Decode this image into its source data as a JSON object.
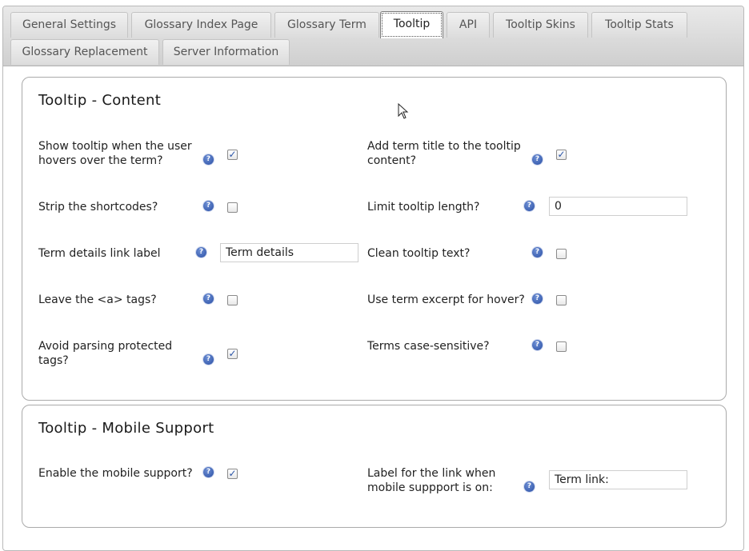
{
  "tabs": [
    {
      "label": "General Settings"
    },
    {
      "label": "Glossary Index Page"
    },
    {
      "label": "Glossary Term"
    },
    {
      "label": "Tooltip"
    },
    {
      "label": "API"
    },
    {
      "label": "Tooltip Skins"
    },
    {
      "label": "Tooltip Stats"
    },
    {
      "label": "Glossary Replacement"
    },
    {
      "label": "Server Information"
    }
  ],
  "active_tab": "Tooltip",
  "content_section": {
    "title": "Tooltip - Content",
    "fields": [
      {
        "label_lines": [
          "Show tooltip when the user",
          "hovers over the term?"
        ],
        "type": "checkbox",
        "checked": true
      },
      {
        "label_lines": [
          "Add term title to the tooltip",
          "content?"
        ],
        "type": "checkbox",
        "checked": true
      },
      {
        "label_lines": [
          "Strip the shortcodes?"
        ],
        "type": "checkbox",
        "checked": false
      },
      {
        "label_lines": [
          "Limit tooltip length?"
        ],
        "type": "text",
        "value": "0"
      },
      {
        "label_lines": [
          "Term details link label"
        ],
        "type": "text",
        "value": "Term details"
      },
      {
        "label_lines": [
          "Clean tooltip text?"
        ],
        "type": "checkbox",
        "checked": false
      },
      {
        "label_lines": [
          "Leave the <a> tags?"
        ],
        "type": "checkbox",
        "checked": false
      },
      {
        "label_lines": [
          "Use term excerpt for hover?"
        ],
        "type": "checkbox",
        "checked": false
      },
      {
        "label_lines": [
          "Avoid parsing protected",
          "tags?"
        ],
        "type": "checkbox",
        "checked": true
      },
      {
        "label_lines": [
          "Terms case-sensitive?"
        ],
        "type": "checkbox",
        "checked": false
      }
    ]
  },
  "mobile_section": {
    "title": "Tooltip - Mobile Support",
    "fields": [
      {
        "label_lines": [
          "Enable the mobile support?"
        ],
        "type": "checkbox",
        "checked": true
      },
      {
        "label_lines": [
          "Label for the link when",
          "mobile suppport is on:"
        ],
        "type": "text",
        "value": "Term link:"
      }
    ]
  },
  "icons": {
    "help": "help-icon",
    "check": "check-icon",
    "cursor": "mouse-pointer-icon"
  },
  "colors": {
    "help_icon": "#2a4fa5",
    "check_mark": "#2b55a8",
    "panel_border": "#aaaaaa"
  }
}
